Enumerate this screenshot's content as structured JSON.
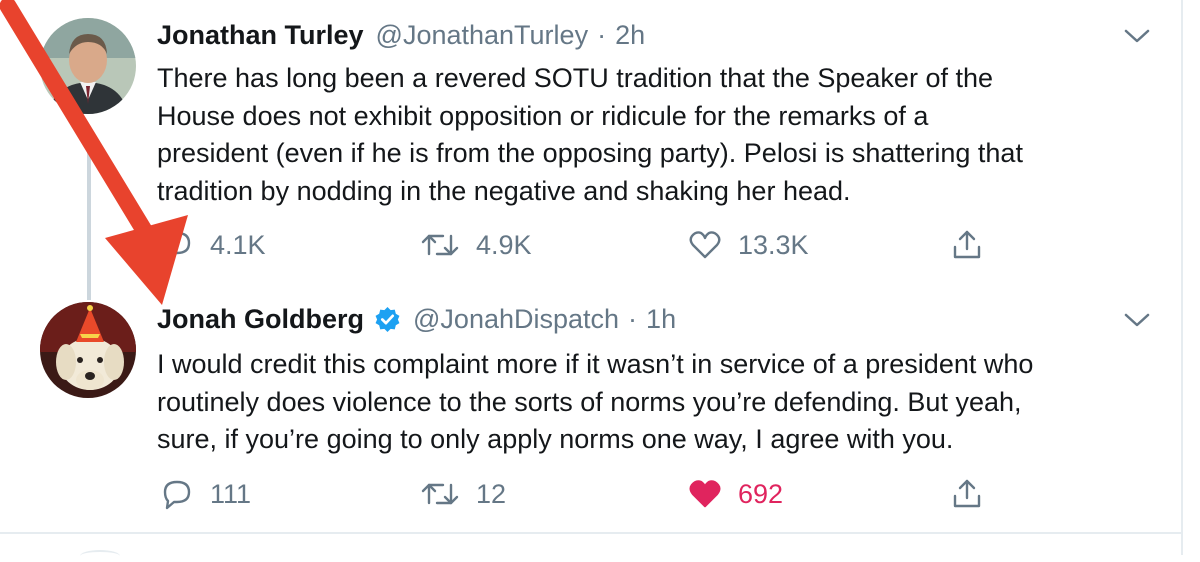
{
  "tweets": [
    {
      "display_name": "Jonathan Turley",
      "handle": "@JonathanTurley",
      "separator": "·",
      "time": "2h",
      "verified": false,
      "avatar_icon": "avatar-photo-man",
      "text_lines": [
        "There has long been a revered SOTU tradition that the Speaker of the",
        "House does not exhibit opposition or ridicule for the remarks of a",
        "president (even if he is from the opposing party). Pelosi is shattering that",
        "tradition by nodding in the negative and shaking her head."
      ],
      "replies": "4.1K",
      "retweets": "4.9K",
      "likes": "13.3K",
      "liked": false
    },
    {
      "display_name": "Jonah Goldberg",
      "handle": "@JonahDispatch",
      "separator": "·",
      "time": "1h",
      "verified": true,
      "avatar_icon": "avatar-photo-dog-party-hat",
      "text_lines": [
        "I would credit this complaint more if it wasn’t in service of a president who",
        "routinely does violence to the sorts of norms you’re defending. But yeah,",
        "sure, if you’re going to only apply norms one way, I agree with you."
      ],
      "replies": "111",
      "retweets": "12",
      "likes": "692",
      "liked": true
    }
  ],
  "colors": {
    "text": "#14171a",
    "secondary": "#657786",
    "verified": "#1da1f2",
    "like": "#e0245e",
    "arrow": "#e8432d",
    "border": "#e6ecf0"
  },
  "icons": [
    "chevron-down-icon",
    "reply-icon",
    "retweet-icon",
    "heart-icon",
    "share-icon",
    "verified-badge-icon",
    "red-arrow-annotation"
  ]
}
